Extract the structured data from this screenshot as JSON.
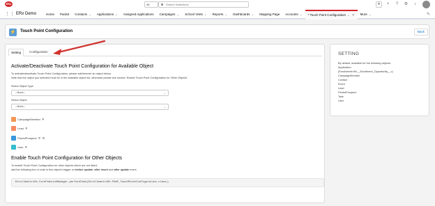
{
  "header": {
    "logo_text": "ERx",
    "search_scope": "All",
    "search_placeholder": "Search Salesforce"
  },
  "nav": {
    "app_name": "ERx Demo",
    "items": [
      {
        "label": "Home",
        "dropdown": false
      },
      {
        "label": "Pardot",
        "dropdown": false
      },
      {
        "label": "Contacts",
        "dropdown": true
      },
      {
        "label": "Applications",
        "dropdown": true
      },
      {
        "label": "Assigned Applications",
        "dropdown": false
      },
      {
        "label": "Campaigns",
        "dropdown": true
      },
      {
        "label": "School Visits",
        "dropdown": true
      },
      {
        "label": "Reports",
        "dropdown": true
      },
      {
        "label": "Dashboards",
        "dropdown": true
      },
      {
        "label": "Mapping Page",
        "dropdown": false
      },
      {
        "label": "Accounts",
        "dropdown": true
      }
    ],
    "active_tab": "* Touch Point Configuration",
    "more": "More"
  },
  "page": {
    "title": "Touch Point Configuration",
    "back_label": "Back"
  },
  "tabs": {
    "setting": "Setting",
    "configuration": "Configuration"
  },
  "available": {
    "heading": "Activate/Deactivate Touch Point Configuration for Available Object",
    "line1": "To activate/deactivate Touch Point Configuration, please add/remove an object below.",
    "line2": "Note that the object you selected must be in the available object list, otherwise please see section 'Enable Touch Point Configuration for Other Objects'",
    "object_type_label": "Select Object Type",
    "object_type_value": "--None--",
    "object_label": "Select Object",
    "object_value": "--None--",
    "pills": [
      {
        "label": "CampaignMember",
        "color": "#f49756"
      },
      {
        "label": "Lead",
        "color": "#f88962"
      },
      {
        "label": "PardotProspect",
        "color": "#3c97dd"
      },
      {
        "label": "User",
        "color": "#34becd"
      }
    ]
  },
  "other": {
    "heading": "Enable Touch Point Configuration for Other Objects",
    "line1": "To enable Touch Point Configuration for other objects which are not listed:",
    "line2_a": "add the following line of code to this object's trigger on ",
    "line2_b": "before update",
    "line2_c": ", ",
    "line2_d": "after insert",
    "line2_e": " and ",
    "line2_f": "after update",
    "line2_g": " event",
    "code": "EnrollmentrxRx.CoreFeatureManager.performTask(EnrollmentrxRx.FKAF_TouchPointConfiguration.class);"
  },
  "side": {
    "title": "SETTING",
    "lines": [
      "By default, available for the following objects:",
      "Application",
      "(EnrollmentrxRx__Enrollment_Opportunity__c)",
      "CampaignMember",
      "Contact",
      "Event",
      "Lead",
      "PardotProspect",
      "Task",
      "User"
    ]
  },
  "colors": {
    "brand_red": "#d2252b",
    "header_icon": "#5a9bd8",
    "link_blue": "#0070d2",
    "arrow": "#d0312d"
  }
}
